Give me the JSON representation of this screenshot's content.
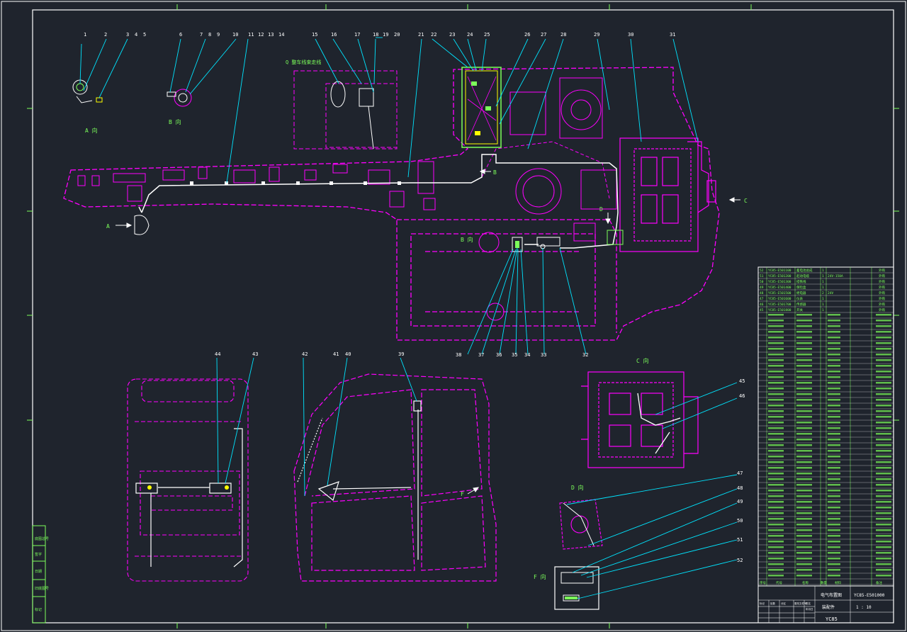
{
  "drawing": {
    "title_block": {
      "drawing_name": "电气布置图",
      "part_code": "YC85",
      "drawing_number": "YC85-E501000",
      "scale_label": "装配件",
      "sheet_text": "1 : 10"
    },
    "view_labels": {
      "a": "A 向",
      "b": "B 向",
      "b2": "B 向",
      "c": "C 向",
      "d": "D 向",
      "f": "F 向",
      "note": "Q 整车线束走线"
    },
    "arrow_labels": {
      "a": "A",
      "b": "B",
      "c": "C",
      "d": "D",
      "f": "F"
    },
    "callouts_top": [
      "1",
      "2",
      "3",
      "4",
      "5",
      "6",
      "7",
      "8",
      "9",
      "10",
      "11",
      "12",
      "13",
      "14",
      "15",
      "16",
      "17",
      "18",
      "19",
      "20",
      "21",
      "22",
      "23",
      "24",
      "25",
      "26",
      "27",
      "28",
      "29",
      "30",
      "31"
    ],
    "callouts_mid": [
      "32",
      "33",
      "34",
      "35",
      "36",
      "37",
      "38"
    ],
    "callouts_bottom": [
      "39",
      "40",
      "41",
      "42",
      "43",
      "44"
    ],
    "callouts_right": [
      "45",
      "46",
      "47",
      "48",
      "49",
      "50",
      "51",
      "52"
    ],
    "left_strip": [
      "底图总号",
      "签字",
      "日期",
      "旧底图号",
      "标记"
    ],
    "bom_rows": [
      [
        "52",
        "YC85-E501100",
        "蓄电池总成",
        "1",
        "",
        "外购"
      ],
      [
        "51",
        "YC85-E501200",
        "起动电缆",
        "1",
        "24V-150A",
        "外购"
      ],
      [
        "50",
        "YC85-E501300",
        "搭铁线",
        "1",
        "",
        "外购"
      ],
      [
        "49",
        "YC85-E501400",
        "保险盒",
        "1",
        "",
        "外购"
      ],
      [
        "48",
        "YC85-E501500",
        "继电器",
        "2",
        "24V",
        "外购"
      ],
      [
        "47",
        "YC85-E501600",
        "仪表",
        "1",
        "",
        "外购"
      ],
      [
        "46",
        "YC85-E501700",
        "传感器",
        "1",
        "",
        "外购"
      ],
      [
        "45",
        "YC85-E501800",
        "开关",
        "1",
        "",
        "外购"
      ]
    ],
    "bom_header": [
      "序号",
      "代号",
      "名称",
      "数量",
      "材料",
      "备注"
    ],
    "block_rows": [
      "标记",
      "处数",
      "分区",
      "更改文件号",
      "签名",
      "年月日"
    ]
  }
}
